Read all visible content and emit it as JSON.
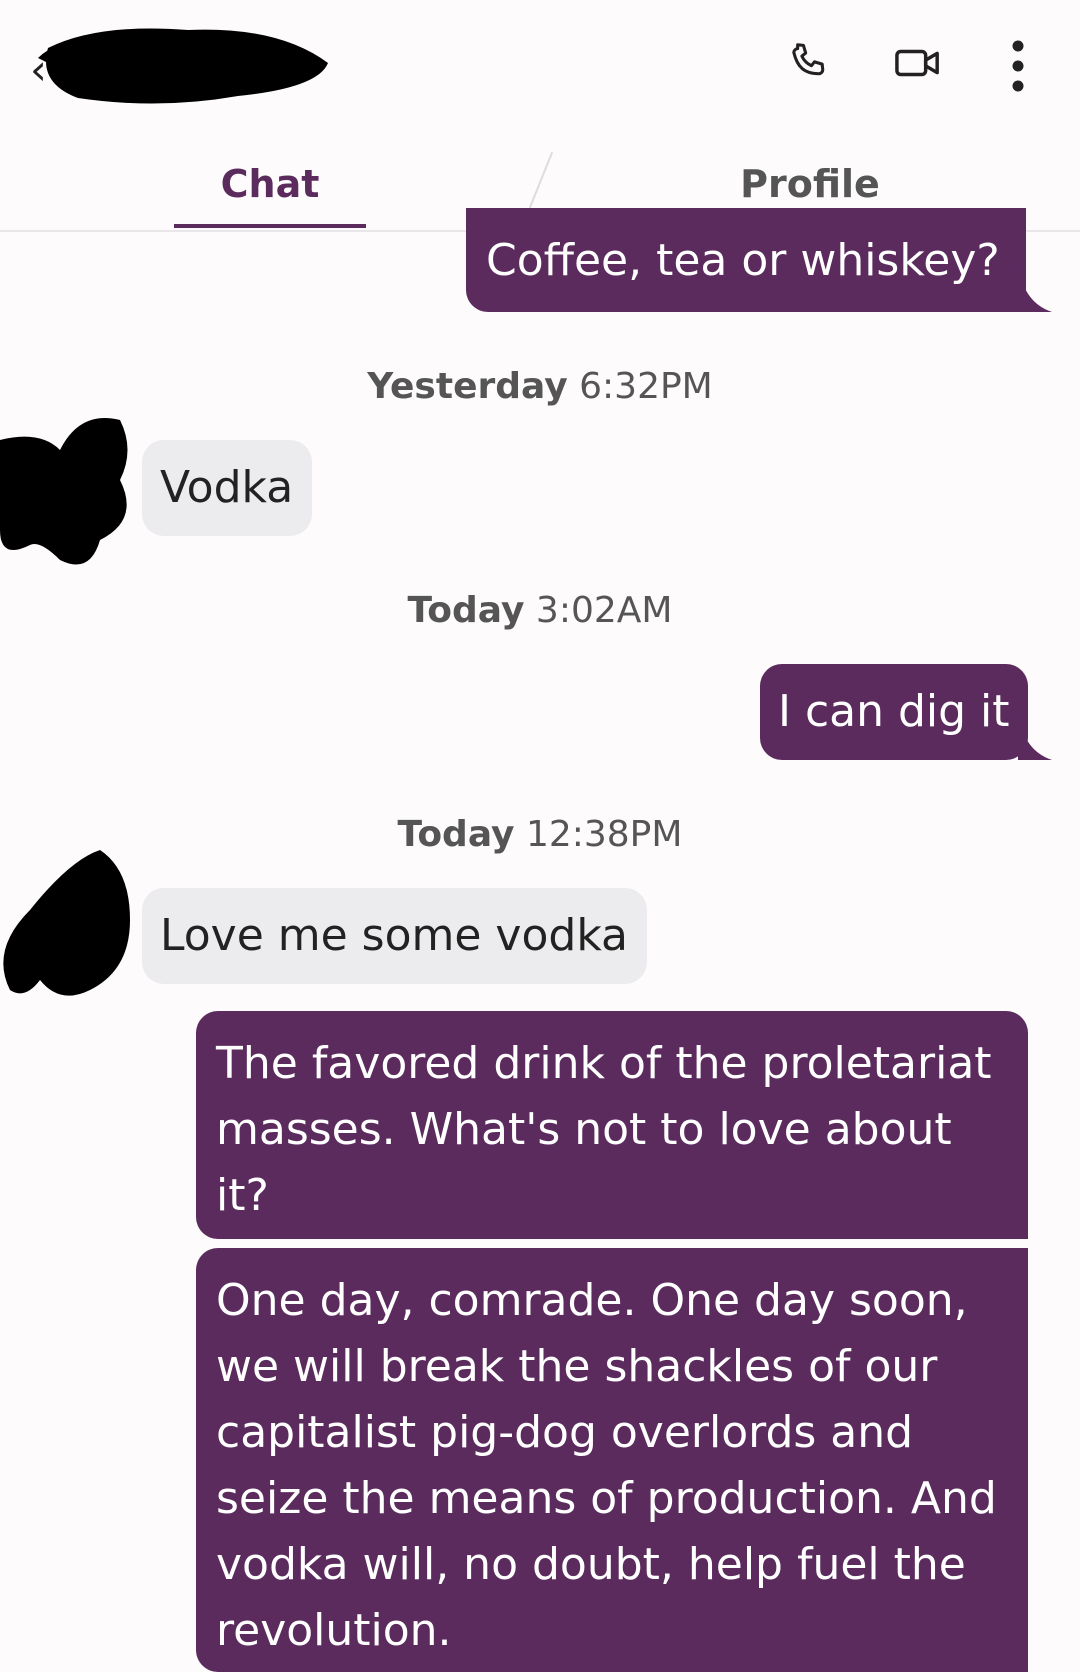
{
  "header": {
    "back_icon": "chevron-left-icon",
    "contact_name": "",
    "actions": [
      "phone-icon",
      "video-icon",
      "more-vert-icon"
    ]
  },
  "tabs": [
    {
      "label": "Chat",
      "active": true
    },
    {
      "label": "Profile",
      "active": false
    }
  ],
  "colors": {
    "accent": "#5c2b5e",
    "incoming_bubble": "#ecebed",
    "background": "#fdfbfc"
  },
  "messages": [
    {
      "direction": "out",
      "text": "Coffee, tea or whiskey?"
    },
    {
      "timestamp_day": "Yesterday",
      "timestamp_time": "6:32PM"
    },
    {
      "direction": "in",
      "text": "Vodka"
    },
    {
      "timestamp_day": "Today",
      "timestamp_time": "3:02AM"
    },
    {
      "direction": "out",
      "text": "I can dig it"
    },
    {
      "timestamp_day": "Today",
      "timestamp_time": "12:38PM"
    },
    {
      "direction": "in",
      "text": "Love me some vodka"
    },
    {
      "direction": "out",
      "text": "The favored drink of the proletariat masses. What's not to love about it?"
    },
    {
      "direction": "out",
      "text": "One day, comrade. One day soon, we will break the shackles of our capitalist pig-dog overlords and seize the means of production. And vodka will, no doubt, help fuel the revolution."
    }
  ]
}
